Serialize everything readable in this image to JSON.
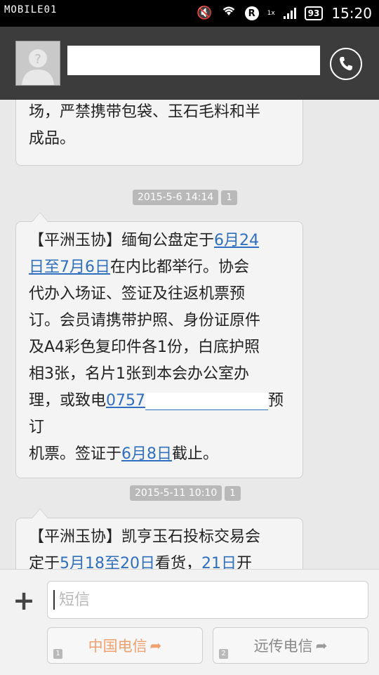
{
  "status_bar": {
    "watermark": "MOBILE01",
    "time": "15:20",
    "battery": "93",
    "network_label": "1x",
    "r_badge": "R"
  },
  "header": {
    "contact_name": "",
    "call_icon": "phone-icon"
  },
  "messages": [
    {
      "text_lines": [
        "场，严禁携带包袋、玉石毛料和半",
        "成品。"
      ]
    },
    {
      "timestamp": "2015-5-6 14:14",
      "sim": "1",
      "parts": {
        "p1": "【平洲玉协】缅甸公盘定于",
        "link1": "6月24",
        "link1b": "日至7月6日",
        "p2": "在内比都举行。协会",
        "p3": "代办入场证、签证及往返机票预",
        "p4": "订。会员请携带护照、身份证原件",
        "p5": "及A4彩色复印件各1份，白底护照",
        "p6": "相3张，名片1张到本会办公室办",
        "p7a": "理，或致电",
        "phone": "0757",
        "p7b": "预订",
        "p8a": "机票。签证于",
        "link3": "6月8日",
        "p8b": "截止。"
      }
    },
    {
      "timestamp": "2015-5-11 10:10",
      "sim": "1",
      "parts": {
        "l1": "【平洲玉协】凯亨玉石投标交易会",
        "l2a": "定于",
        "link_a": "5月18至",
        "link_b": "20日",
        "l2b": "看货，",
        "link_c": "21日",
        "l2c": "开"
      }
    }
  ],
  "composer": {
    "placeholder": "短信",
    "plus_label": "+",
    "sim1": {
      "label": "中国电信",
      "slot": "1",
      "color": "#f0a070"
    },
    "sim2": {
      "label": "远传电信",
      "slot": "2",
      "color": "#888888"
    }
  }
}
